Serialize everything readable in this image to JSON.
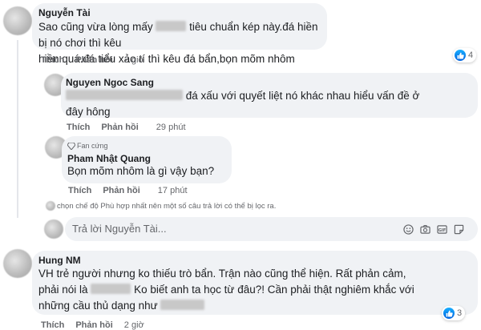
{
  "comments": [
    {
      "author": "Nguyễn Tài",
      "line1a": "Sao cũng vừa lòng mấy",
      "line1b": "tiêu chuẩn kép này.đá hiền bị nó chơi thì kêu",
      "line2": "hiền quá.đá tiểu xảo tí thì kêu đá bẩn,bọn mõm nhôm",
      "like_label": "Thích",
      "reply_label": "Phản hồi",
      "time": "2 giờ",
      "reaction_count": "4"
    },
    {
      "author": "Nguyen Ngoc Sang",
      "line1b": "đá xấu với quyết liệt nó khác nhau hiểu vấn đề ở",
      "line2": "đây hông",
      "like_label": "Thích",
      "reply_label": "Phản hồi",
      "time": "29 phút"
    },
    {
      "badge": "Fan cứng",
      "author": "Pham Nhật Quang",
      "line1": "Bọn mõm nhôm là gì vậy bạn?",
      "like_label": "Thích",
      "reply_label": "Phản hồi",
      "time": "17 phút"
    }
  ],
  "filter_notice": "chọn chế độ Phù hợp nhất nên một số câu trả lời có thể bị lọc ra.",
  "reply_input": {
    "placeholder": "Trả lời Nguyễn Tài..."
  },
  "comment4": {
    "author": "Hung NM",
    "line1": "VH trẻ người nhưng ko thiếu trò bẩn. Trận nào cũng thể hiện. Rất phản cảm,",
    "line2a": "phải nói là",
    "line2b": "Ko biết anh ta học từ đâu?! Cần phải thật nghiêm khắc với",
    "line3a": "những cầu thủ dạng như",
    "like_label": "Thích",
    "reply_label": "Phản hồi",
    "time": "2 giờ",
    "reaction_count": "3"
  },
  "colors": {
    "bubble": "#f0f2f5",
    "meta": "#65676b",
    "like_blue": "#1877f2"
  }
}
